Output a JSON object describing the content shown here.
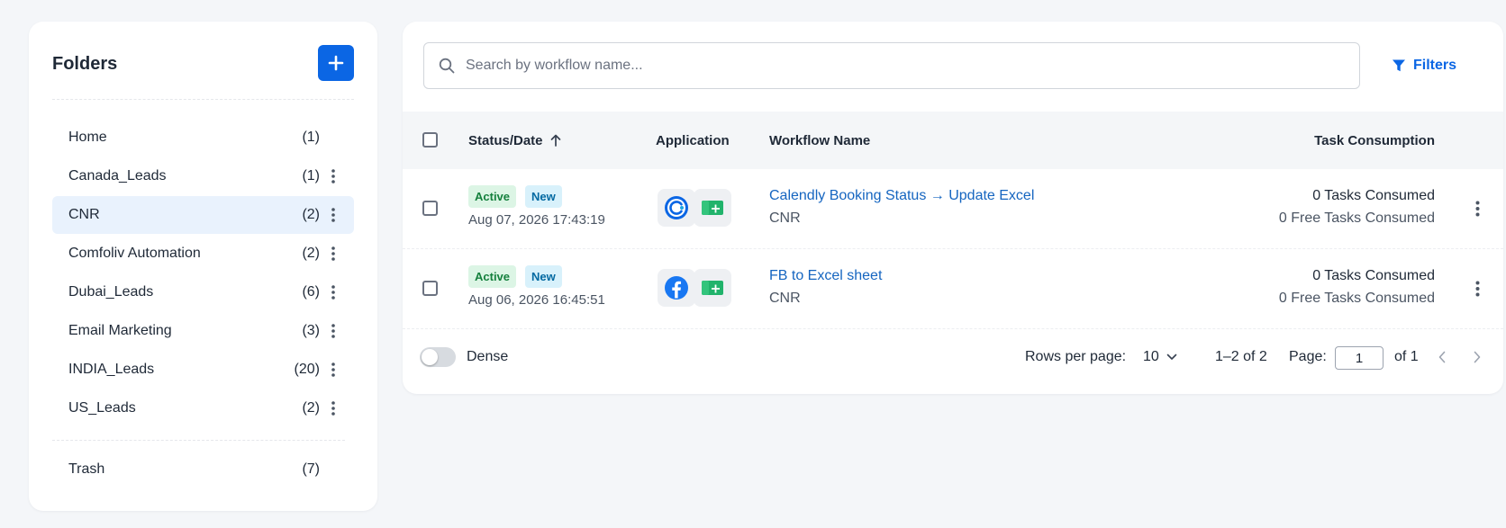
{
  "folders": {
    "title": "Folders",
    "add_button_label": "+",
    "items": [
      {
        "name": "Home",
        "count": "(1)",
        "has_menu": false,
        "selected": false
      },
      {
        "name": "Canada_Leads",
        "count": "(1)",
        "has_menu": true,
        "selected": false
      },
      {
        "name": "CNR",
        "count": "(2)",
        "has_menu": true,
        "selected": true
      },
      {
        "name": "Comfoliv Automation",
        "count": "(2)",
        "has_menu": true,
        "selected": false
      },
      {
        "name": "Dubai_Leads",
        "count": "(6)",
        "has_menu": true,
        "selected": false
      },
      {
        "name": "Email Marketing",
        "count": "(3)",
        "has_menu": true,
        "selected": false
      },
      {
        "name": "INDIA_Leads",
        "count": "(20)",
        "has_menu": true,
        "selected": false
      },
      {
        "name": "US_Leads",
        "count": "(2)",
        "has_menu": true,
        "selected": false
      }
    ],
    "trash": {
      "name": "Trash",
      "count": "(7)"
    }
  },
  "search": {
    "placeholder": "Search by workflow name...",
    "value": ""
  },
  "filters_label": "Filters",
  "table": {
    "headers": {
      "status_date": "Status/Date",
      "application": "Application",
      "workflow_name": "Workflow Name",
      "task_consumption": "Task Consumption"
    },
    "sort": {
      "column": "status_date",
      "direction": "ascending",
      "icon": "arrow-up-icon"
    },
    "rows": [
      {
        "status": "Active",
        "tag": "New",
        "date": "Aug 07, 2026 17:43:19",
        "apps": [
          "calendly-icon",
          "excel-sheet-icon"
        ],
        "name": "Calendly Booking Status → Update Excel",
        "folder": "CNR",
        "tasks": "0 Tasks Consumed",
        "free_tasks": "0 Free Tasks Consumed"
      },
      {
        "status": "Active",
        "tag": "New",
        "date": "Aug 06, 2026 16:45:51",
        "apps": [
          "facebook-icon",
          "excel-sheet-icon"
        ],
        "name": "FB to Excel sheet",
        "folder": "CNR",
        "tasks": "0 Tasks Consumed",
        "free_tasks": "0 Free Tasks Consumed"
      }
    ]
  },
  "footer": {
    "dense_label": "Dense",
    "dense_enabled": false,
    "rows_per_page_label": "Rows per page:",
    "rows_per_page_value": "10",
    "range_text": "1–2 of 2",
    "page_label": "Page:",
    "page_value": "1",
    "of_text": "of 1"
  },
  "colors": {
    "accent": "#0b66e4",
    "link": "#1565c0",
    "selected_folder_bg": "#e9f2fd",
    "badge_active_bg": "#dcf5e5",
    "badge_active_text": "#15803d",
    "badge_new_bg": "#d8f1fb",
    "badge_new_text": "#0369a1"
  }
}
